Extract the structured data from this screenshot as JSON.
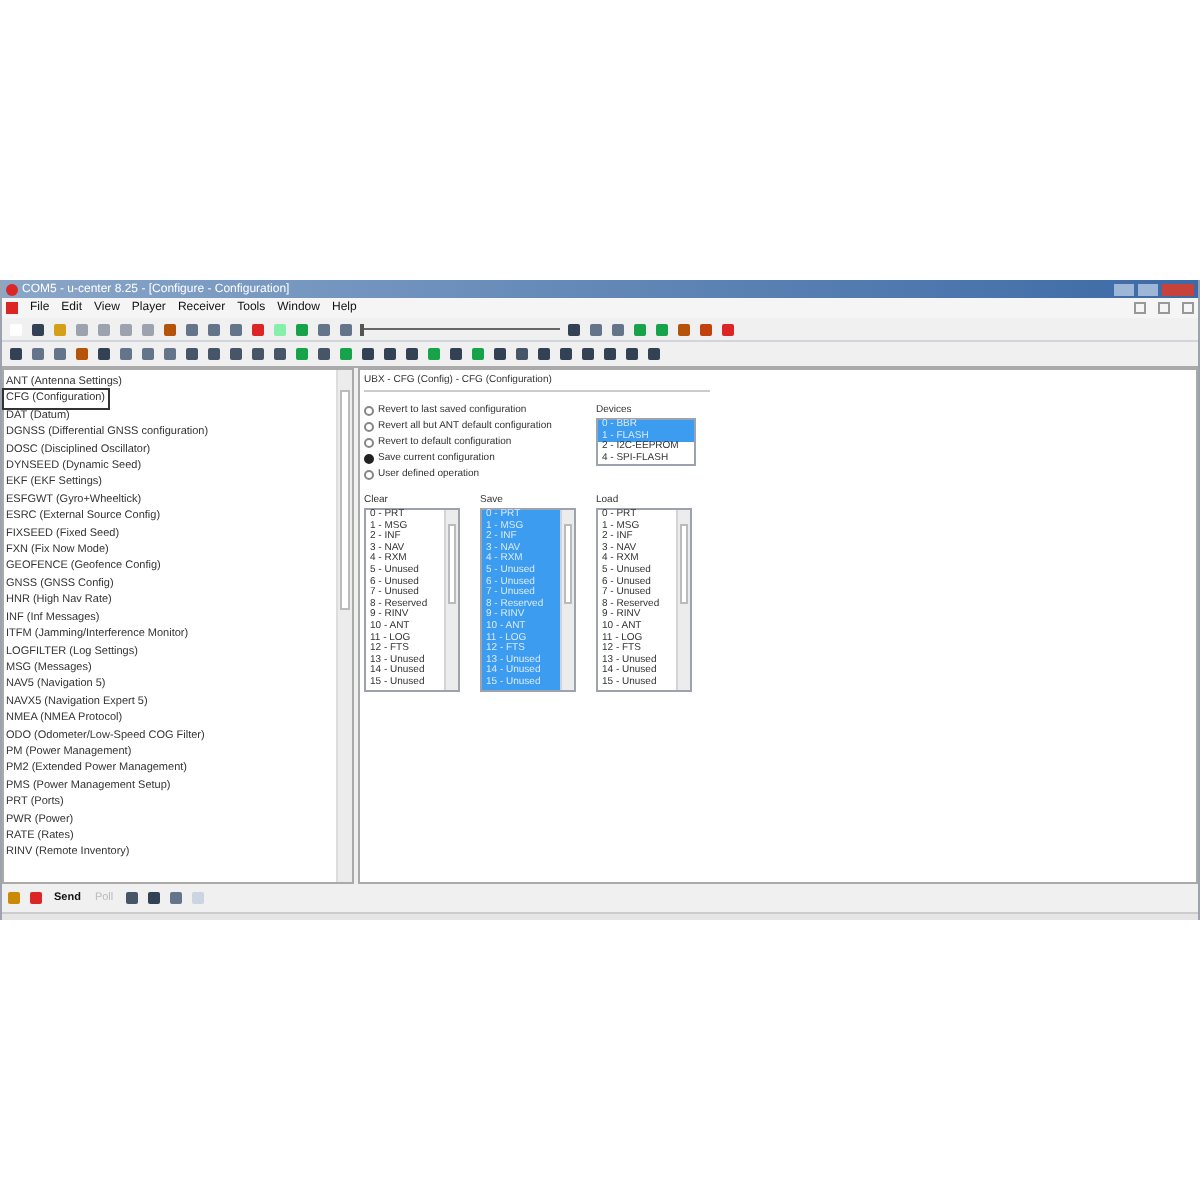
{
  "window": {
    "title": "COM5 - u-center 8.25 - [Configure - Configuration]"
  },
  "player": {
    "level": 0
  },
  "menu": [
    {
      "label": "File"
    },
    {
      "label": "Edit"
    },
    {
      "label": "View"
    },
    {
      "label": "Player"
    },
    {
      "label": "Receiver"
    },
    {
      "label": "Tools"
    },
    {
      "label": "Window"
    },
    {
      "label": "Help"
    }
  ],
  "sidebar": {
    "items": [
      {
        "label": "ANT (Antenna Settings)",
        "selected": false
      },
      {
        "label": "CFG (Configuration)",
        "selected": true
      },
      {
        "label": "DAT (Datum)",
        "selected": false
      },
      {
        "label": "DGNSS (Differential GNSS configuration)",
        "selected": false
      },
      {
        "label": "DOSC (Disciplined Oscillator)",
        "selected": false
      },
      {
        "label": "DYNSEED (Dynamic Seed)",
        "selected": false
      },
      {
        "label": "EKF (EKF Settings)",
        "selected": false
      },
      {
        "label": "ESFGWT (Gyro+Wheeltick)",
        "selected": false
      },
      {
        "label": "ESRC (External Source Config)",
        "selected": false
      },
      {
        "label": "FIXSEED (Fixed Seed)",
        "selected": false
      },
      {
        "label": "FXN (Fix Now Mode)",
        "selected": false
      },
      {
        "label": "GEOFENCE (Geofence Config)",
        "selected": false
      },
      {
        "label": "GNSS (GNSS Config)",
        "selected": false
      },
      {
        "label": "HNR (High Nav Rate)",
        "selected": false
      },
      {
        "label": "INF (Inf Messages)",
        "selected": false
      },
      {
        "label": "ITFM (Jamming/Interference Monitor)",
        "selected": false
      },
      {
        "label": "LOGFILTER (Log Settings)",
        "selected": false
      },
      {
        "label": "MSG (Messages)",
        "selected": false
      },
      {
        "label": "NAV5 (Navigation 5)",
        "selected": false
      },
      {
        "label": "NAVX5 (Navigation Expert 5)",
        "selected": false
      },
      {
        "label": "NMEA (NMEA Protocol)",
        "selected": false
      },
      {
        "label": "ODO (Odometer/Low-Speed COG Filter)",
        "selected": false
      },
      {
        "label": "PM (Power Management)",
        "selected": false
      },
      {
        "label": "PM2 (Extended Power Management)",
        "selected": false
      },
      {
        "label": "PMS (Power Management Setup)",
        "selected": false
      },
      {
        "label": "PRT (Ports)",
        "selected": false
      },
      {
        "label": "PWR (Power)",
        "selected": false
      },
      {
        "label": "RATE (Rates)",
        "selected": false
      },
      {
        "label": "RINV (Remote Inventory)",
        "selected": false
      }
    ]
  },
  "panel": {
    "title": "UBX - CFG (Config) - CFG (Configuration)",
    "options": [
      {
        "label": "Revert to last saved configuration",
        "selected": false
      },
      {
        "label": "Revert all but ANT default configuration",
        "selected": false
      },
      {
        "label": "Revert to default configuration",
        "selected": false
      },
      {
        "label": "Save current configuration",
        "selected": true
      },
      {
        "label": "User defined operation",
        "selected": false
      }
    ],
    "devices": {
      "label": "Devices",
      "items": [
        {
          "label": "0 - BBR",
          "selected": true
        },
        {
          "label": "1 - FLASH",
          "selected": true
        },
        {
          "label": "2 - I2C-EEPROM",
          "selected": false
        },
        {
          "label": "4 - SPI-FLASH",
          "selected": false
        }
      ]
    },
    "lists": [
      {
        "label": "Clear",
        "items": [
          {
            "label": "0 - PRT",
            "selected": false
          },
          {
            "label": "1 - MSG",
            "selected": false
          },
          {
            "label": "2 - INF",
            "selected": false
          },
          {
            "label": "3 - NAV",
            "selected": false
          },
          {
            "label": "4 - RXM",
            "selected": false
          },
          {
            "label": "5 - Unused",
            "selected": false
          },
          {
            "label": "6 - Unused",
            "selected": false
          },
          {
            "label": "7 - Unused",
            "selected": false
          },
          {
            "label": "8 - Reserved",
            "selected": false
          },
          {
            "label": "9 - RINV",
            "selected": false
          },
          {
            "label": "10 - ANT",
            "selected": false
          },
          {
            "label": "11 - LOG",
            "selected": false
          },
          {
            "label": "12 - FTS",
            "selected": false
          },
          {
            "label": "13 - Unused",
            "selected": false
          },
          {
            "label": "14 - Unused",
            "selected": false
          },
          {
            "label": "15 - Unused",
            "selected": false
          }
        ]
      },
      {
        "label": "Save",
        "items": [
          {
            "label": "0 - PRT",
            "selected": true
          },
          {
            "label": "1 - MSG",
            "selected": true
          },
          {
            "label": "2 - INF",
            "selected": true
          },
          {
            "label": "3 - NAV",
            "selected": true
          },
          {
            "label": "4 - RXM",
            "selected": true
          },
          {
            "label": "5 - Unused",
            "selected": true
          },
          {
            "label": "6 - Unused",
            "selected": true
          },
          {
            "label": "7 - Unused",
            "selected": true
          },
          {
            "label": "8 - Reserved",
            "selected": true
          },
          {
            "label": "9 - RINV",
            "selected": true
          },
          {
            "label": "10 - ANT",
            "selected": true
          },
          {
            "label": "11 - LOG",
            "selected": true
          },
          {
            "label": "12 - FTS",
            "selected": true
          },
          {
            "label": "13 - Unused",
            "selected": true
          },
          {
            "label": "14 - Unused",
            "selected": true
          },
          {
            "label": "15 - Unused",
            "selected": true
          }
        ]
      },
      {
        "label": "Load",
        "items": [
          {
            "label": "0 - PRT",
            "selected": false
          },
          {
            "label": "1 - MSG",
            "selected": false
          },
          {
            "label": "2 - INF",
            "selected": false
          },
          {
            "label": "3 - NAV",
            "selected": false
          },
          {
            "label": "4 - RXM",
            "selected": false
          },
          {
            "label": "5 - Unused",
            "selected": false
          },
          {
            "label": "6 - Unused",
            "selected": false
          },
          {
            "label": "7 - Unused",
            "selected": false
          },
          {
            "label": "8 - Reserved",
            "selected": false
          },
          {
            "label": "9 - RINV",
            "selected": false
          },
          {
            "label": "10 - ANT",
            "selected": false
          },
          {
            "label": "11 - LOG",
            "selected": false
          },
          {
            "label": "12 - FTS",
            "selected": false
          },
          {
            "label": "13 - Unused",
            "selected": false
          },
          {
            "label": "14 - Unused",
            "selected": false
          },
          {
            "label": "15 - Unused",
            "selected": false
          }
        ]
      }
    ]
  },
  "bottom_bar": {
    "buttons": [
      {
        "label": "Send",
        "disabled": false
      },
      {
        "label": "Poll",
        "disabled": true
      }
    ]
  }
}
